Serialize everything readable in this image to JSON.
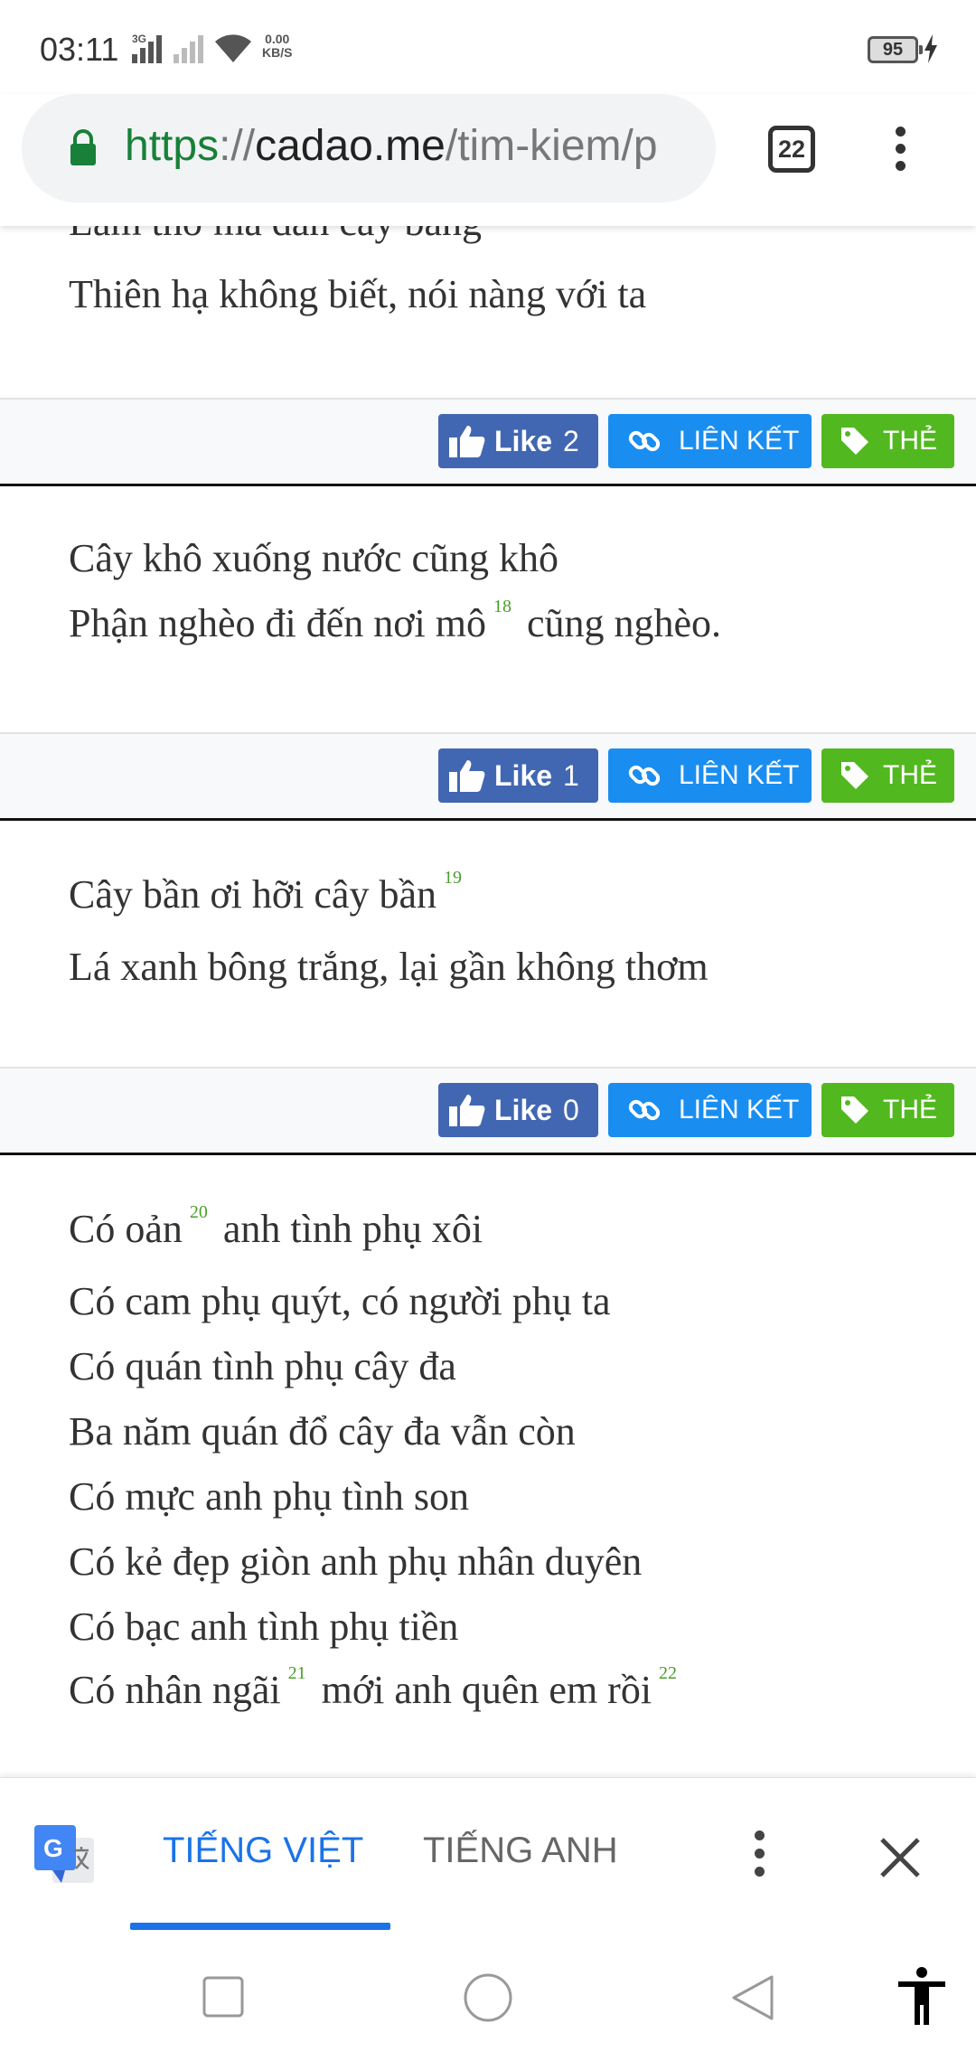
{
  "status_bar": {
    "time": "03:11",
    "network_type": "3G",
    "data_speed_value": "0.00",
    "data_speed_unit": "KB/S",
    "battery_level": "95"
  },
  "browser": {
    "url_scheme": "https",
    "url_sep": "://",
    "url_host": "cadao.me",
    "url_path": "/tim-kiem/p",
    "tab_count": "22"
  },
  "poems": [
    {
      "lines": [
        {
          "text": "Làm thơ mà đan cây bằng"
        },
        {
          "text": "Thiên hạ không biết, nói nàng với ta"
        }
      ],
      "likes": "2"
    },
    {
      "lines": [
        {
          "text": "Cây khô xuống nước cũng khô"
        },
        {
          "text": "Phận nghèo đi đến nơi mô",
          "note": "18",
          "after": "cũng nghèo."
        }
      ],
      "likes": "1"
    },
    {
      "lines": [
        {
          "text": "Cây bần ơi hỡi cây bần",
          "note": "19"
        },
        {
          "text": "Lá xanh bông trắng, lại gần không thơm"
        }
      ],
      "likes": "0"
    },
    {
      "lines": [
        {
          "text": "Có oản",
          "note": "20",
          "after": "anh tình phụ xôi"
        },
        {
          "text": "Có cam phụ quýt, có người phụ ta"
        },
        {
          "text": "Có quán tình phụ cây đa"
        },
        {
          "text": "Ba năm quán đổ cây đa vẫn còn"
        },
        {
          "text": "Có mực anh phụ tình son"
        },
        {
          "text": "Có kẻ đẹp giòn anh phụ nhân duyên"
        },
        {
          "text": "Có bạc anh tình phụ tiền"
        },
        {
          "text": "Có nhân ngãi",
          "note": "21",
          "after": "mới anh quên em rồi",
          "note2": "22"
        }
      ]
    }
  ],
  "actions": {
    "like_label": "Like",
    "link_label": "LIÊN KẾT",
    "tag_label": "THẺ"
  },
  "translate": {
    "tab_source": "TIẾNG VIỆT",
    "tab_target": "TIẾNG ANH"
  },
  "colors": {
    "like_blue": "#4267b2",
    "link_blue": "#1a8ef0",
    "tag_green": "#52b81f",
    "translate_accent": "#1a73e8",
    "footnote_green": "#4a9e2a",
    "secure_green": "#188038"
  },
  "icons": {
    "status": [
      "signal-icon",
      "wifi-icon",
      "battery-icon",
      "charging-icon"
    ],
    "browser": [
      "lock-icon",
      "tab-switcher-icon",
      "more-vert-icon"
    ],
    "actions": [
      "thumbs-up-icon",
      "link-icon",
      "tag-icon"
    ],
    "translate": [
      "google-translate-icon",
      "more-vert-icon",
      "close-icon"
    ],
    "nav": [
      "recents-icon",
      "home-icon",
      "back-icon",
      "accessibility-icon"
    ]
  }
}
